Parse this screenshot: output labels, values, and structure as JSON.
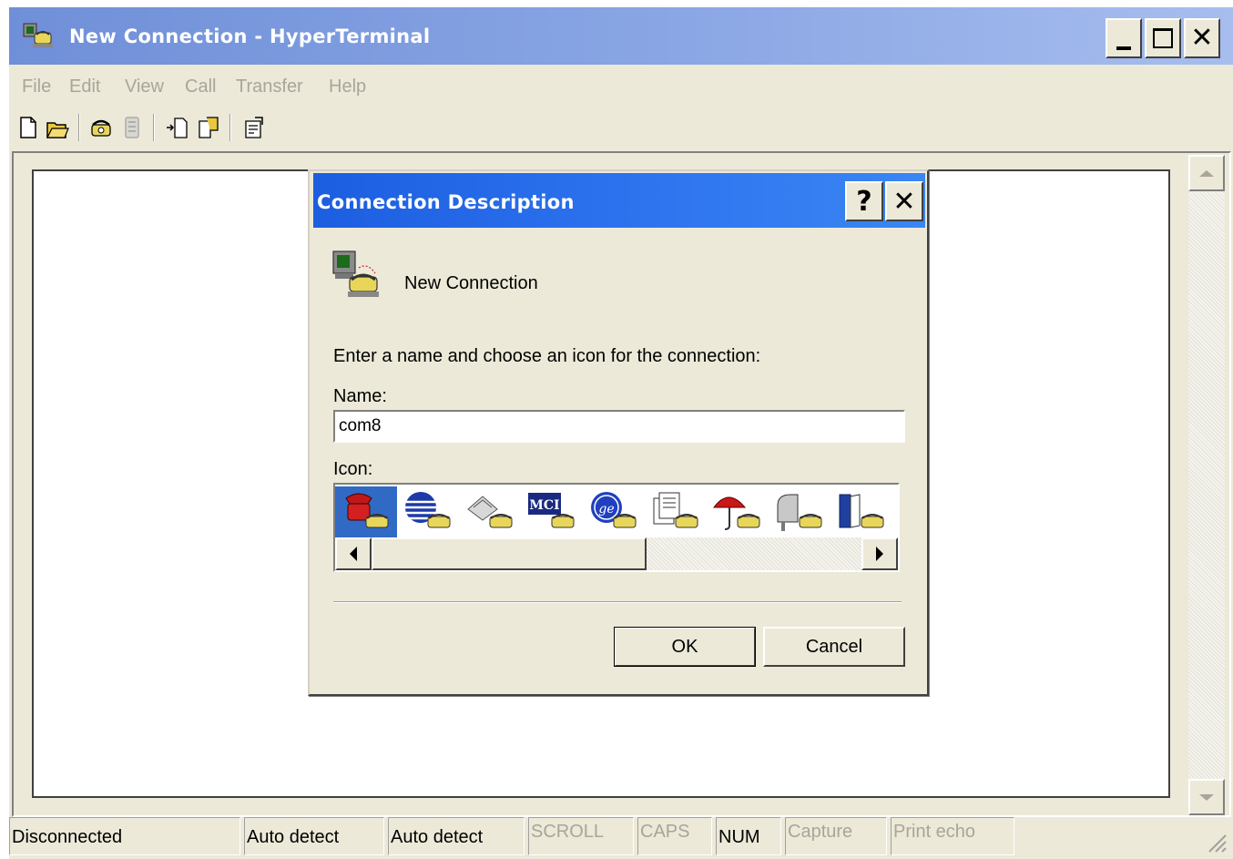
{
  "window": {
    "title": "New Connection - HyperTerminal"
  },
  "menu": {
    "items": [
      "File",
      "Edit",
      "View",
      "Call",
      "Transfer",
      "Help"
    ]
  },
  "toolbar": {
    "buttons": [
      "new-icon",
      "open-icon",
      "call-icon",
      "disconnect-icon",
      "send-icon",
      "receive-icon",
      "properties-icon"
    ]
  },
  "dialog": {
    "title": "Connection Description",
    "help_button": "?",
    "close_button": "✕",
    "connection_name": "New Connection",
    "prompt": "Enter a name and choose an icon for the connection:",
    "name_label": "Name:",
    "name_value": "com8",
    "icon_label": "Icon:",
    "icons": [
      "red-phone-icon",
      "globe-phone-icon",
      "fax-phone-icon",
      "mci-phone-icon",
      "ge-phone-icon",
      "documents-phone-icon",
      "umbrella-phone-icon",
      "mailbox-phone-icon",
      "book-phone-icon"
    ],
    "selected_icon_index": 0,
    "ok_label": "OK",
    "cancel_label": "Cancel"
  },
  "status": {
    "connection": "Disconnected",
    "detect1": "Auto detect",
    "detect2": "Auto detect",
    "scroll": "SCROLL",
    "caps": "CAPS",
    "num": "NUM",
    "capture": "Capture",
    "print_echo": "Print echo"
  },
  "colors": {
    "title_bar": "#8aa6e4",
    "dialog_title": "#2c72ee",
    "selection": "#316ac5",
    "face": "#ece9d8"
  }
}
